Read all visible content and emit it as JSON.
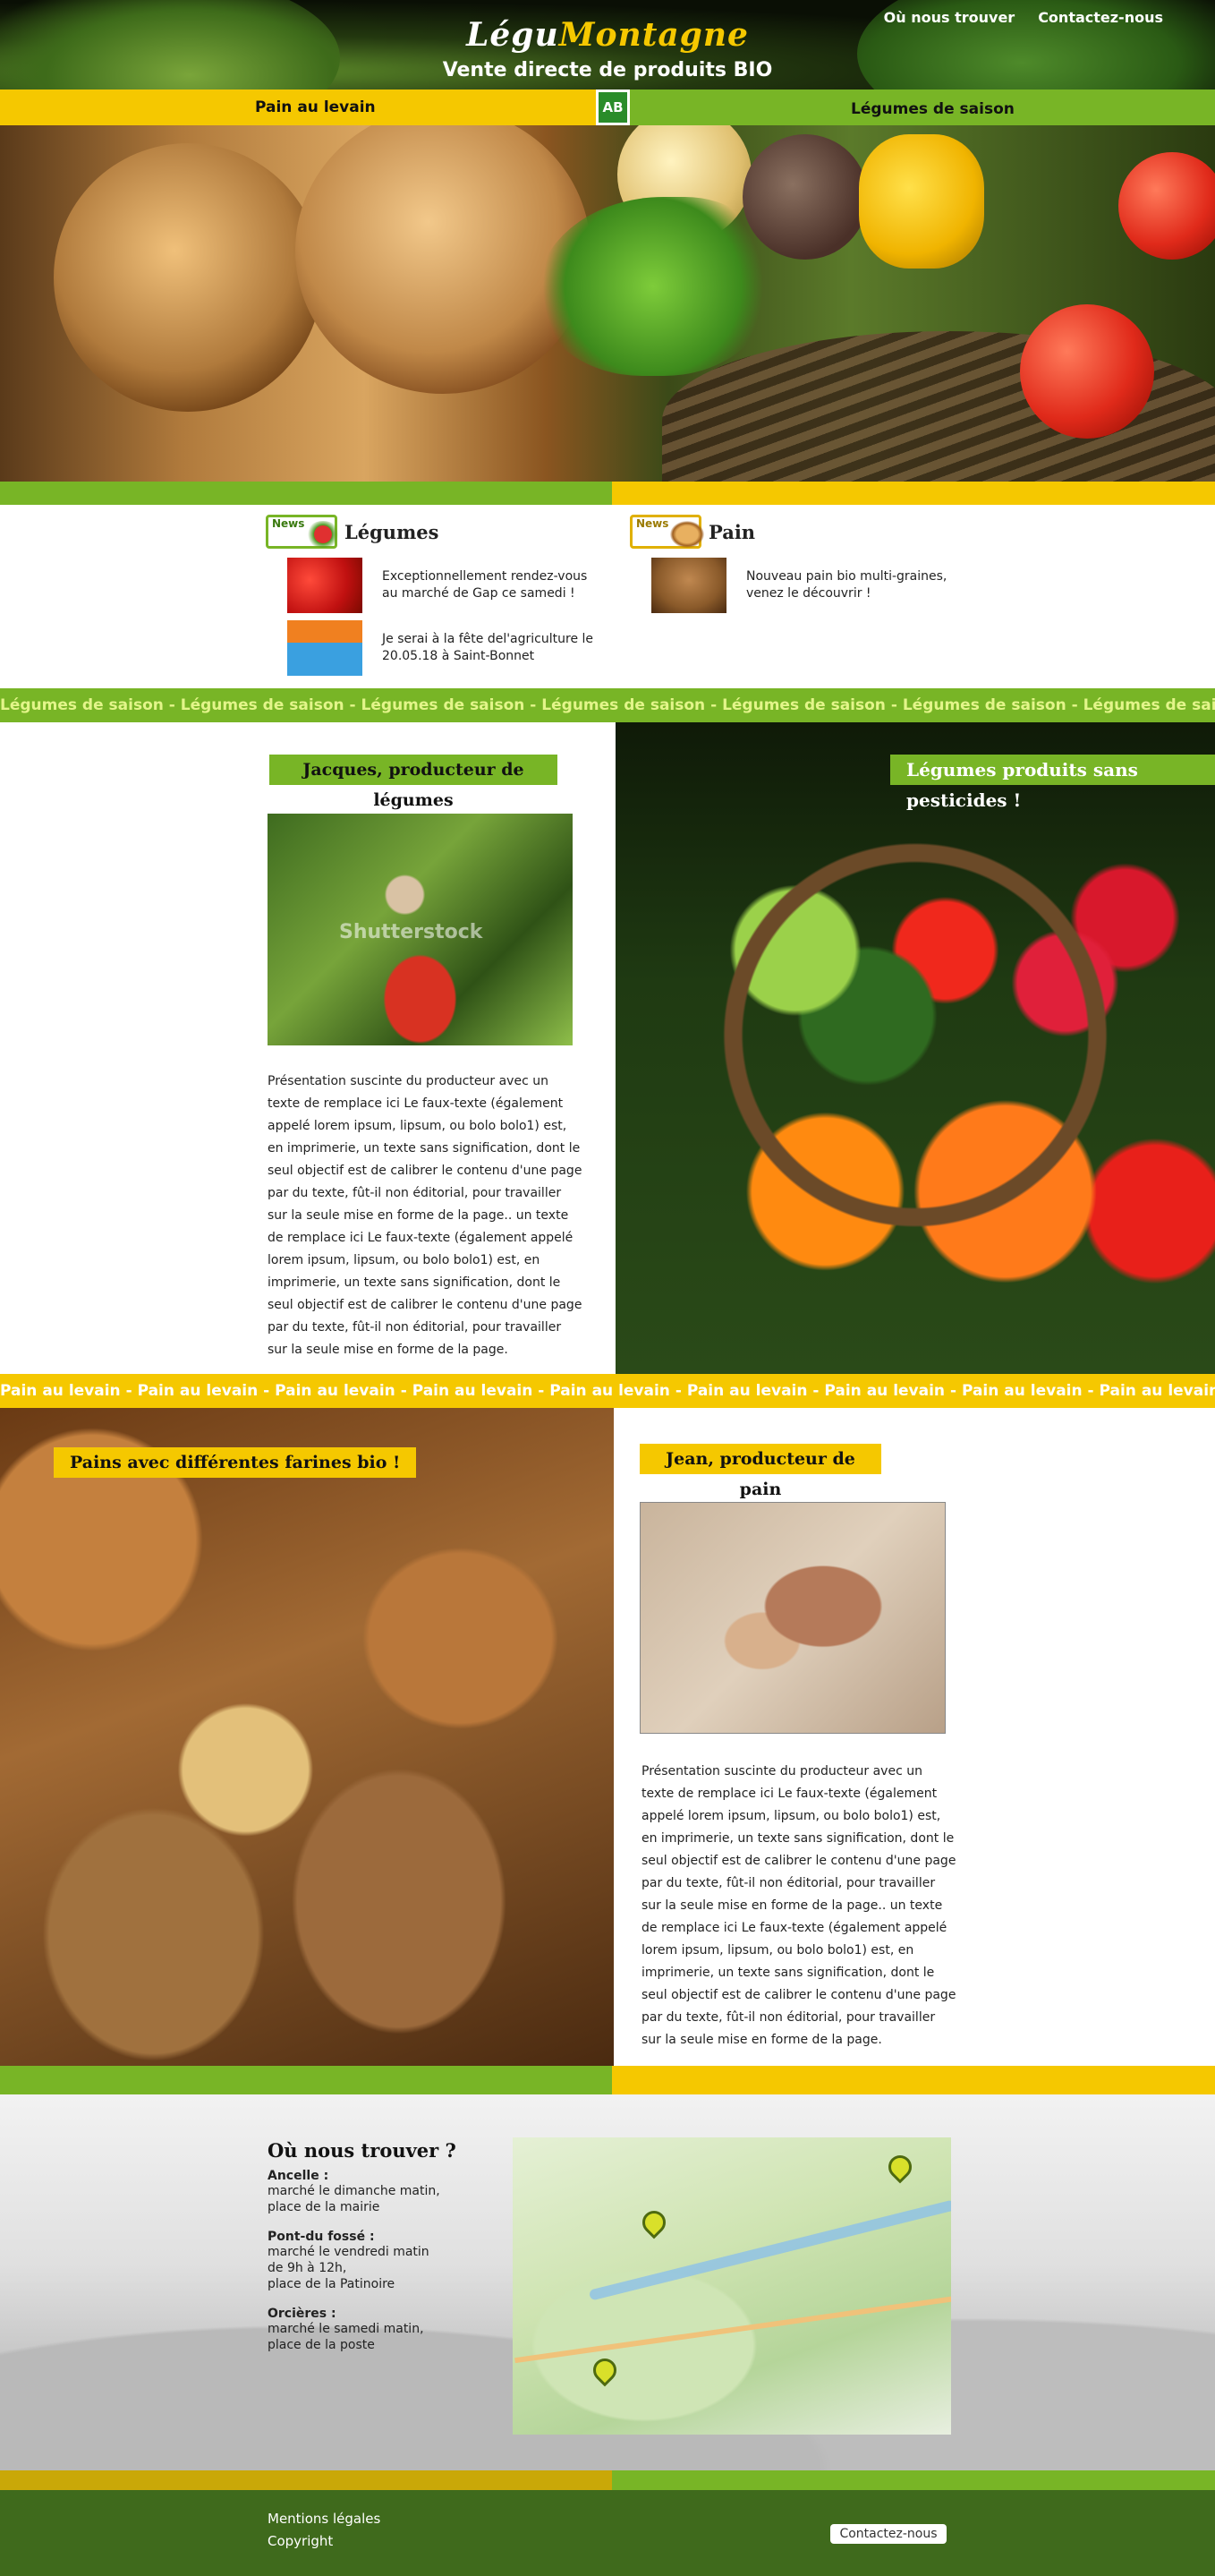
{
  "header": {
    "logo_part1": "Légu",
    "logo_part2": "Montagne",
    "tagline": "Vente  directe de produits BIO",
    "nav": [
      "Où nous trouver",
      "Contactez-nous"
    ]
  },
  "categories": {
    "left": "Pain au levain",
    "right": "Légumes de saison",
    "badge": "AB"
  },
  "news": {
    "badge_label": "News",
    "legumes": {
      "title": "Légumes",
      "items": [
        "Exceptionnellement rendez-vous au marché de Gap ce samedi !",
        "Je serai à la fête del'agriculture le 20.05.18 à Saint-Bonnet"
      ]
    },
    "pain": {
      "title": "Pain",
      "items": [
        "Nouveau pain bio multi-graines, venez le découvrir !"
      ]
    }
  },
  "marquee_legumes": "Légumes de saison",
  "marquee_pain": "Pain au levain",
  "producer_legumes": {
    "title": "Jacques, producteur de légumes",
    "text": "Présentation suscinte du producteur avec un texte de remplace ici Le faux-texte (également appelé lorem ipsum, lipsum, ou bolo bolo1) est, en imprimerie, un texte sans signification, dont le seul objectif est de calibrer le contenu d'une page par du texte, fût-il non éditorial, pour travailler sur la seule mise en forme de la page.. un texte de remplace ici Le faux-texte (également appelé lorem ipsum, lipsum, ou bolo bolo1) est, en imprimerie, un texte sans signification, dont le seul objectif est de calibrer le contenu d'une page par du texte, fût-il non éditorial, pour travailler sur la seule mise en forme de la page.",
    "photo_watermark": "Shutterstock",
    "banner": "Légumes produits sans pesticides !"
  },
  "producer_pain": {
    "banner": "Pains avec différentes farines bio !",
    "title": "Jean, producteur de pain",
    "text": "Présentation suscinte du producteur avec un texte de remplace ici Le faux-texte (également appelé lorem ipsum, lipsum, ou bolo bolo1) est, en imprimerie, un texte sans signification, dont le seul objectif est de calibrer le contenu d'une page par du texte, fût-il non éditorial, pour travailler sur la seule mise en forme de la page.. un texte de remplace ici Le faux-texte (également appelé lorem ipsum, lipsum, ou bolo bolo1) est, en imprimerie, un texte sans signification, dont le seul objectif est de calibrer le contenu d'une page par du texte, fût-il non éditorial, pour travailler sur la seule mise en forme de la page."
  },
  "find_us": {
    "title": "Où nous trouver ?",
    "places": [
      {
        "name": "Ancelle :",
        "desc": [
          "marché le dimanche matin,",
          "place de la mairie"
        ]
      },
      {
        "name": "Pont-du fossé :",
        "desc": [
          "marché le vendredi matin",
          "de 9h à 12h,",
          "place de la Patinoire"
        ]
      },
      {
        "name": "Orcières :",
        "desc": [
          "marché le samedi matin,",
          "place de la poste"
        ]
      }
    ]
  },
  "footer": {
    "legal": "Mentions légales",
    "copyright": "Copyright",
    "contact": "Contactez-nous"
  },
  "colors": {
    "green": "#78b526",
    "yellow": "#f5c800",
    "footer_green": "#3f6a1c"
  }
}
